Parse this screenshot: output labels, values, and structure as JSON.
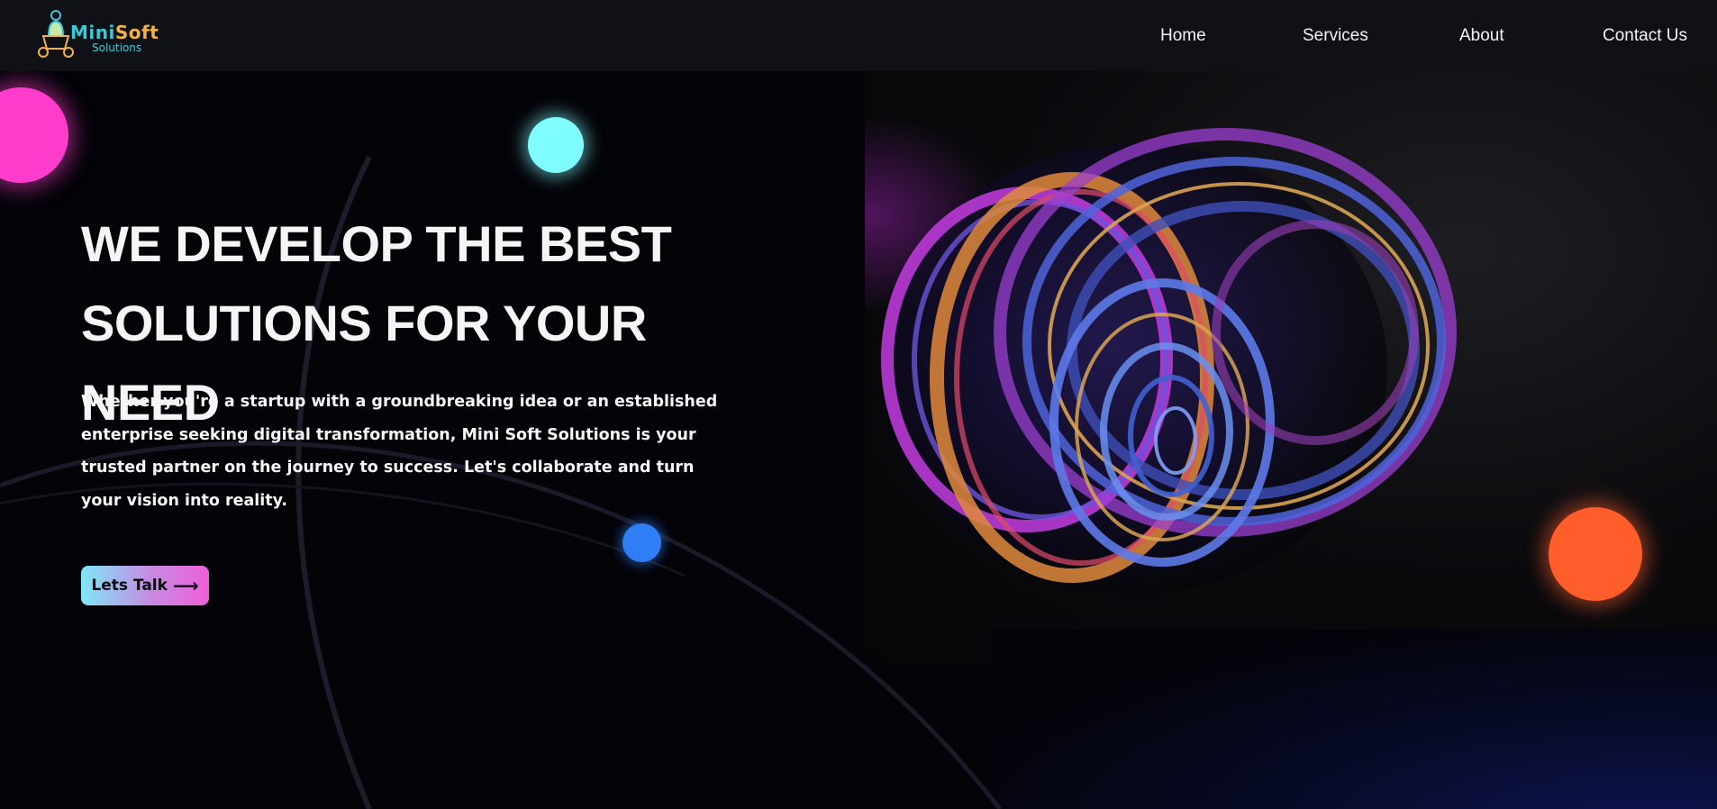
{
  "brand": {
    "name_part1": "Mini",
    "name_part2": "Soft",
    "subtitle": "Solutions",
    "logo_icon": "figure-on-laptop-icon"
  },
  "nav": {
    "items": [
      {
        "label": "Home"
      },
      {
        "label": "Services"
      },
      {
        "label": "About"
      },
      {
        "label": "Contact Us"
      }
    ]
  },
  "hero": {
    "heading_line1": "WE DEVELOP THE BEST",
    "heading_line2": "SOLUTIONS FOR YOUR NEED",
    "description": "Whether you're a startup with a groundbreaking idea or an established enterprise seeking digital transformation, Mini Soft Solutions is your trusted partner on the journey to success. Let's collaborate and turn your vision into reality.",
    "cta_label": "Lets Talk",
    "cta_icon": "arrow-right-icon"
  },
  "colors": {
    "nav_bg": "#101117",
    "page_bg": "#030308",
    "orb_pink": "#ff3ccc",
    "orb_cyan": "#7ffcff",
    "orb_blue": "#2f7ef5",
    "orb_orange": "#ff5d2a",
    "logo_teal": "#39c9d6",
    "logo_gold": "#f1b247"
  }
}
